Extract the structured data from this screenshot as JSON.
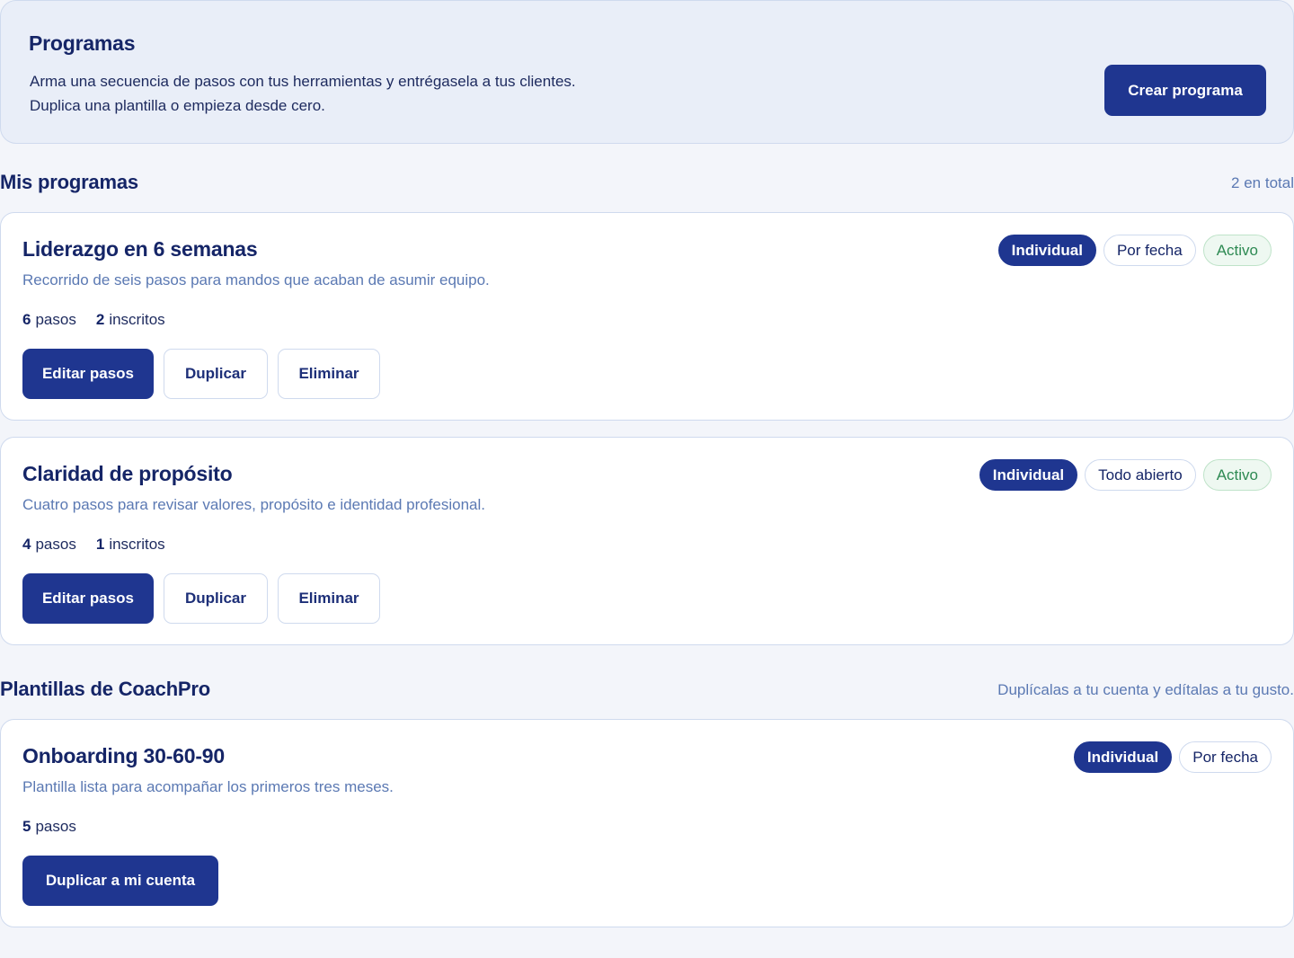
{
  "header": {
    "title": "Programas",
    "description_line1": "Arma una secuencia de pasos con tus herramientas y entrégasela a tus clientes.",
    "description_line2": "Duplica una plantilla o empieza desde cero.",
    "create_button": "Crear programa"
  },
  "my_programs": {
    "title": "Mis programas",
    "count_label": "2 en total",
    "items": [
      {
        "title": "Liderazgo en 6 semanas",
        "description": "Recorrido de seis pasos para mandos que acaban de asumir equipo.",
        "steps_value": "6",
        "steps_label": "pasos",
        "enrolled_value": "2",
        "enrolled_label": "inscritos",
        "badges": [
          "Individual",
          "Por fecha",
          "Activo"
        ],
        "edit_button": "Editar pasos",
        "duplicate_button": "Duplicar",
        "delete_button": "Eliminar"
      },
      {
        "title": "Claridad de propósito",
        "description": "Cuatro pasos para revisar valores, propósito e identidad profesional.",
        "steps_value": "4",
        "steps_label": "pasos",
        "enrolled_value": "1",
        "enrolled_label": "inscritos",
        "badges": [
          "Individual",
          "Todo abierto",
          "Activo"
        ],
        "edit_button": "Editar pasos",
        "duplicate_button": "Duplicar",
        "delete_button": "Eliminar"
      }
    ]
  },
  "templates": {
    "title": "Plantillas de CoachPro",
    "subtitle": "Duplícalas a tu cuenta y edítalas a tu gusto.",
    "items": [
      {
        "title": "Onboarding 30-60-90",
        "description": "Plantilla lista para acompañar los primeros tres meses.",
        "steps_value": "5",
        "steps_label": "pasos",
        "badges": [
          "Individual",
          "Por fecha"
        ],
        "copy_button": "Duplicar a mi cuenta"
      }
    ]
  },
  "colors": {
    "primary": "#1f3690",
    "heading": "#152567",
    "muted": "#5b79b3",
    "active_green": "#2e8a53",
    "page_bg": "#f3f5fa"
  }
}
